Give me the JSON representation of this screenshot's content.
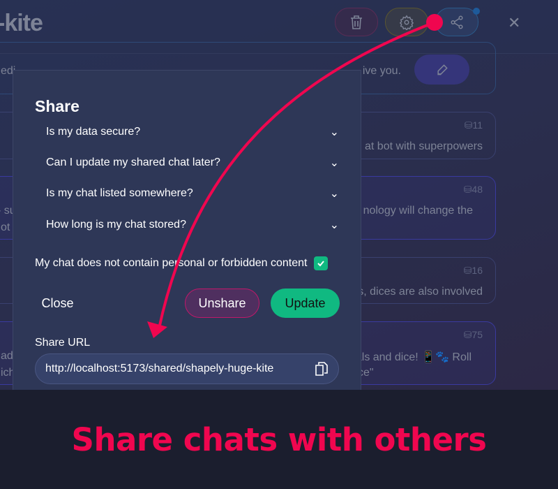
{
  "header": {
    "title": "-kite",
    "close_icon": "close-icon"
  },
  "background_cards": [
    {
      "left": "edi",
      "right": "ive you."
    },
    {
      "count": "11",
      "right": "at bot with superpowers"
    },
    {
      "count": "48",
      "left1": "- su",
      "left2": "ot",
      "right": "nology will change the"
    },
    {
      "count": "16",
      "right": "s, dices are also involved"
    },
    {
      "count": "75",
      "left1": "ad",
      "left2": "ich",
      "right1": "als and dice! 📱🐾 Roll",
      "right2": "ce\""
    }
  ],
  "modal": {
    "title": "Share",
    "faqs": [
      "Is my data secure?",
      "Can I update my shared chat later?",
      "Is my chat listed somewhere?",
      "How long is my chat stored?"
    ],
    "checkbox_label": "My chat does not contain personal or forbidden content",
    "checked": true,
    "close_label": "Close",
    "unshare_label": "Unshare",
    "update_label": "Update",
    "url_label": "Share URL",
    "url": "http://localhost:5173/shared/shapely-huge-kite"
  },
  "banner": {
    "text": "Share chats with others"
  },
  "colors": {
    "accent": "#f0064f",
    "update": "#10b981",
    "unshare": "#4f2f5f"
  }
}
